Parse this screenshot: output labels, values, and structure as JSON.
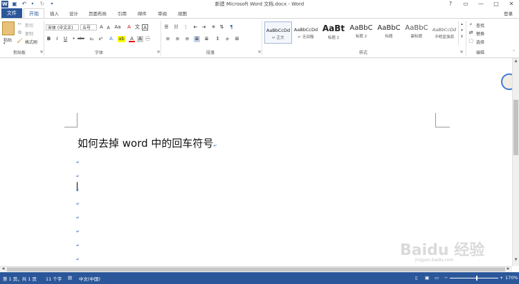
{
  "window": {
    "title": "新建 Microsoft Word 文档.docx - Word",
    "controls": {
      "help": "?",
      "restore": "▭",
      "minimize": "—",
      "maximize": "□",
      "close": "✕"
    },
    "quick_access": {
      "save_icon": "💾",
      "undo": "↶",
      "redo": "↻",
      "customize": "▾"
    }
  },
  "tabs": [
    "文件",
    "开始",
    "插入",
    "设计",
    "页面布局",
    "引用",
    "邮件",
    "审阅",
    "视图"
  ],
  "account": "登录",
  "ribbon": {
    "clipboard": {
      "group": "剪贴板",
      "paste": "粘贴",
      "cut": "剪切",
      "copy": "复制",
      "format_painter": "格式刷"
    },
    "font": {
      "group": "字体",
      "font_name": "宋体 (中文正)",
      "font_size": "五号",
      "grow": "A",
      "shrink": "A",
      "case": "Aa",
      "clear": "A",
      "wen": "文",
      "border_a": "A",
      "bold": "B",
      "italic": "I",
      "underline": "U",
      "strike": "abc",
      "sub": "x₂",
      "sup": "x²",
      "text_effect": "A",
      "highlight": "ab",
      "font_color": "A",
      "shade": "A",
      "circle": "㊀"
    },
    "paragraph": {
      "group": "段落"
    },
    "styles": {
      "group": "样式",
      "items": [
        {
          "sample": "AaBbCcDd",
          "name": "↵ 正文"
        },
        {
          "sample": "AaBbCcDd",
          "name": "↵ 无间隔"
        },
        {
          "sample": "AaBt",
          "name": "标题 1"
        },
        {
          "sample": "AaBbC",
          "name": "标题 2"
        },
        {
          "sample": "AaBbC",
          "name": "标题"
        },
        {
          "sample": "AaBbC",
          "name": "副标题"
        },
        {
          "sample": "AaBbCcDd",
          "name": "不明显强调"
        }
      ]
    },
    "editing": {
      "group": "编辑",
      "find": "查找",
      "replace": "替换",
      "select": "选择"
    }
  },
  "document": {
    "heading": "如何去掉 word 中的回车符号",
    "heading_mark": "↵",
    "para_mark": "↵",
    "empty_paragraphs": 8
  },
  "status": {
    "page": "第 1 页，共 1 页",
    "words": "11 个字",
    "language": "中文(中国)",
    "zoom": "170%",
    "zoom_minus": "−",
    "zoom_plus": "+"
  },
  "watermark": "Baidu 经验",
  "watermark_url": "jingyan.baidu.com",
  "colors": {
    "accent": "#2b579a",
    "paragraph_mark": "#2b579a"
  }
}
